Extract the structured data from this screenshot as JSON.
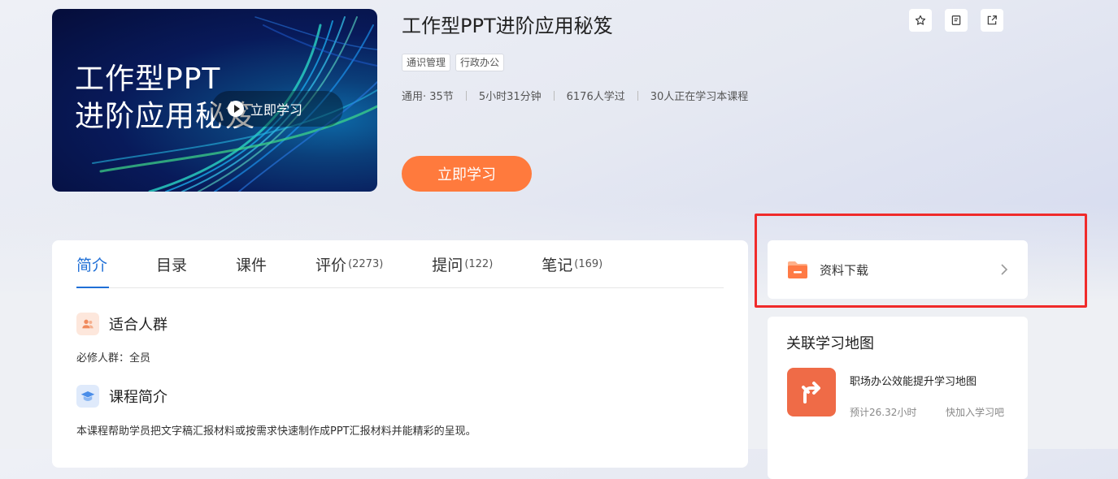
{
  "cover": {
    "title": "工作型PPT\n进阶应用秘笈",
    "play_label": "立即学习"
  },
  "course": {
    "title": "工作型PPT进阶应用秘笈",
    "tags": [
      "通识管理",
      "行政办公"
    ],
    "meta": [
      "通用· 35节",
      "5小时31分钟",
      "6176人学过",
      "30人正在学习本课程"
    ],
    "start_label": "立即学习"
  },
  "actions": {
    "icons": [
      "star-icon",
      "notes-icon",
      "share-icon"
    ]
  },
  "tabs": [
    {
      "label": "简介",
      "count": ""
    },
    {
      "label": "目录",
      "count": ""
    },
    {
      "label": "课件",
      "count": ""
    },
    {
      "label": "评价",
      "count": "(2273)"
    },
    {
      "label": "提问",
      "count": "(122)"
    },
    {
      "label": "笔记",
      "count": "(169)"
    }
  ],
  "intro": {
    "audience_title": "适合人群",
    "audience_text": "必修人群：全员",
    "summary_title": "课程简介",
    "summary_text": "本课程帮助学员把文字稿汇报材料或按需求快速制作成PPT汇报材料并能精彩的呈现。"
  },
  "download": {
    "label": "资料下载"
  },
  "map": {
    "title": "关联学习地图",
    "name": "职场办公效能提升学习地图",
    "estimate": "预计26.32小时",
    "join": "快加入学习吧"
  },
  "colors": {
    "accent": "#ff7a3d",
    "tab_active": "#1f6fd6",
    "highlight": "#f02b2b",
    "map_thumb": "#ef6b47"
  }
}
